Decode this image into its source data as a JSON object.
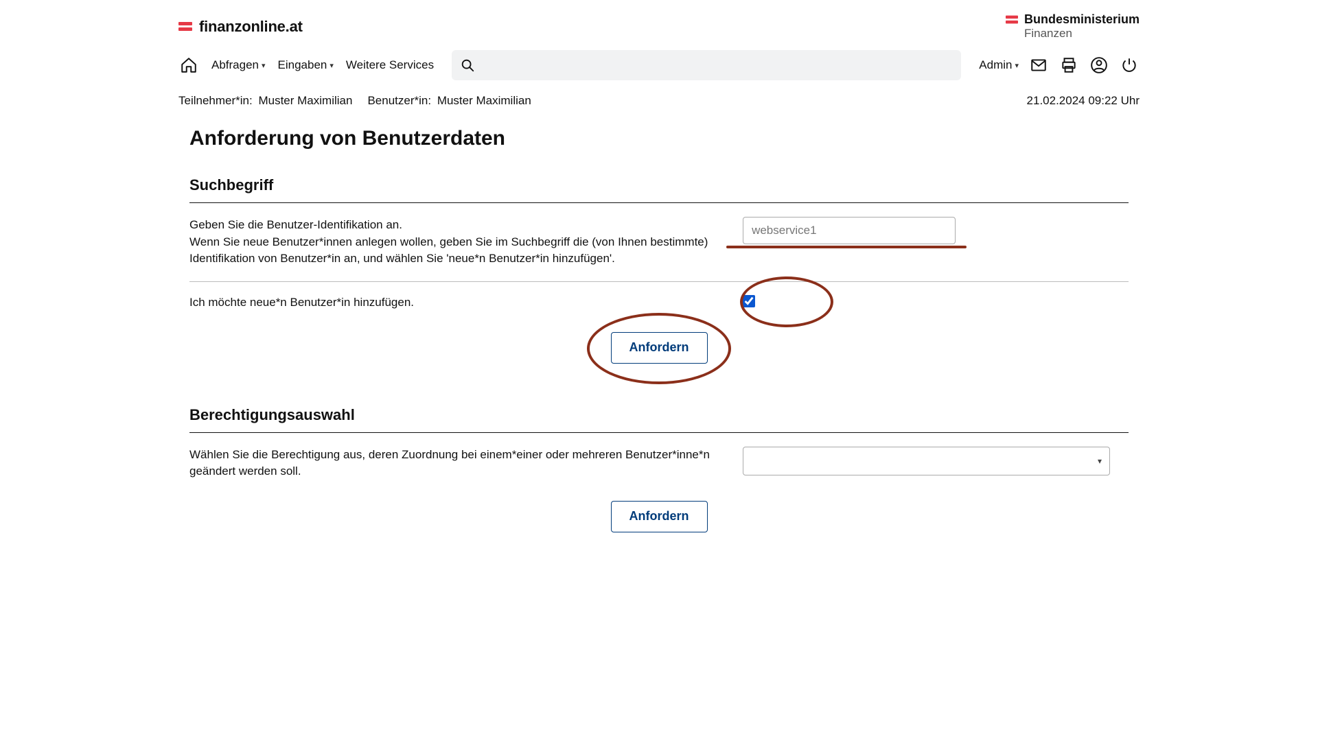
{
  "site": {
    "name": "finanzonline.at"
  },
  "ministry": {
    "name": "Bundesministerium",
    "sub": "Finanzen"
  },
  "nav": {
    "abfragen": "Abfragen",
    "eingaben": "Eingaben",
    "weitere": "Weitere Services",
    "admin": "Admin"
  },
  "info": {
    "teilnehmer_label": "Teilnehmer*in:",
    "teilnehmer_value": "Muster Maximilian",
    "benutzer_label": "Benutzer*in:",
    "benutzer_value": "Muster Maximilian",
    "timestamp": "21.02.2024  09:22 Uhr"
  },
  "page": {
    "title": "Anforderung von Benutzerdaten",
    "section1": {
      "heading": "Suchbegriff",
      "desc_line1": "Geben Sie die Benutzer-Identifikation an.",
      "desc_line2": "Wenn Sie neue Benutzer*innen anlegen wollen, geben Sie im Suchbegriff die (von Ihnen bestimmte) Identifikation von Benutzer*in an, und wählen Sie 'neue*n Benutzer*in hinzufügen'.",
      "input_value": "webservice1",
      "checkbox_label": "Ich möchte neue*n Benutzer*in hinzufügen.",
      "button": "Anfordern"
    },
    "section2": {
      "heading": "Berechtigungsauswahl",
      "desc": "Wählen Sie die Berechtigung aus, deren Zuordnung bei einem*einer oder mehreren Benutzer*inne*n geändert werden soll.",
      "button": "Anfordern"
    }
  }
}
